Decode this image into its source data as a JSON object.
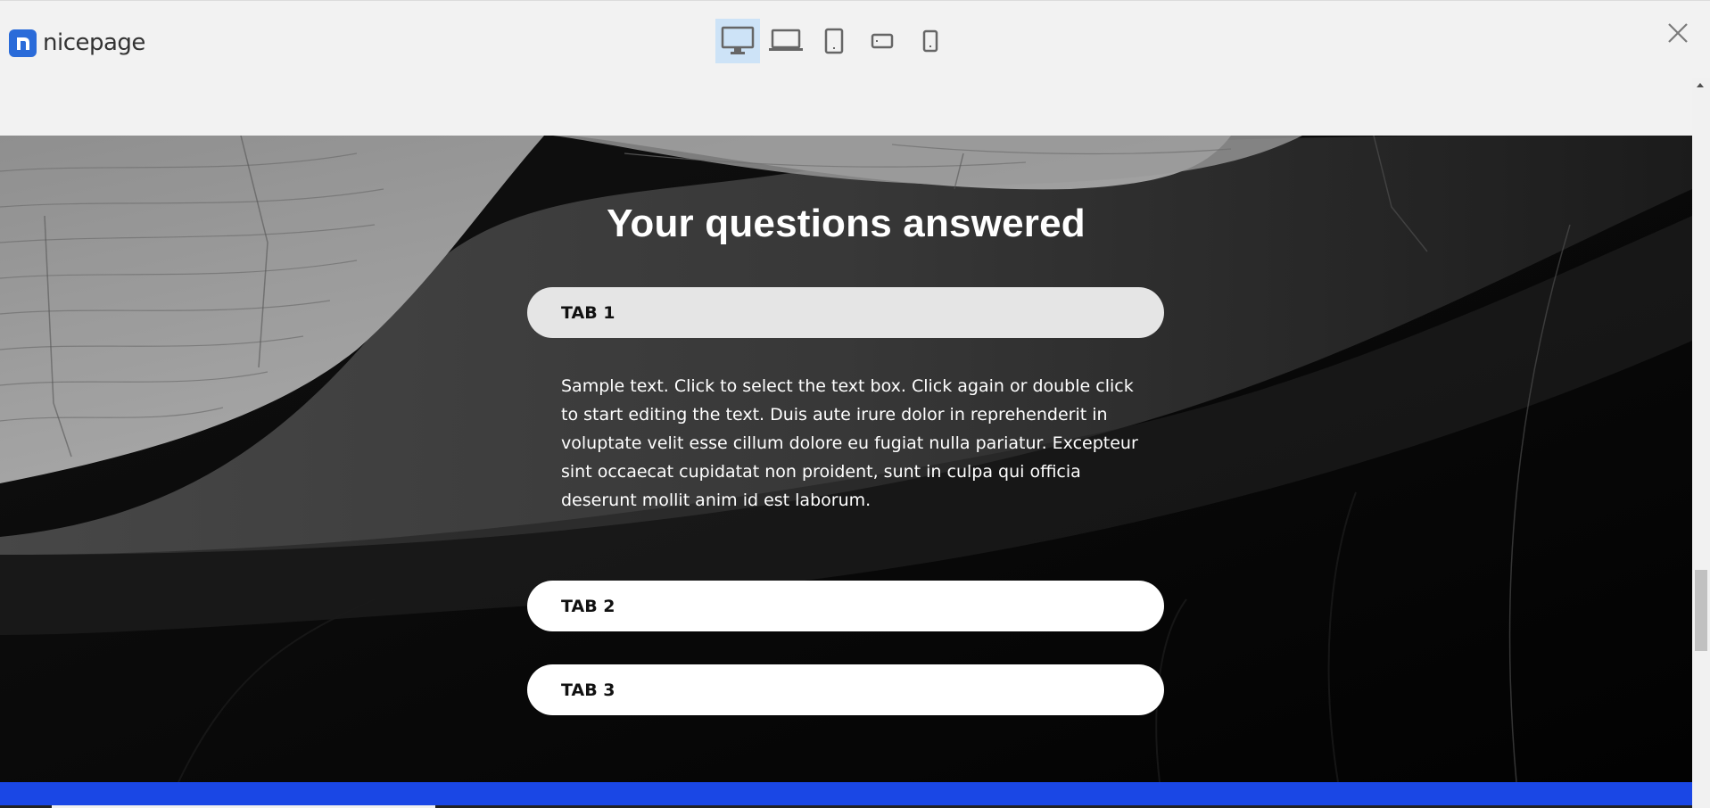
{
  "app": {
    "brand": "nicepage",
    "device_modes": [
      {
        "name": "desktop",
        "active": true
      },
      {
        "name": "laptop",
        "active": false
      },
      {
        "name": "tablet",
        "active": false
      },
      {
        "name": "phone-landscape",
        "active": false
      },
      {
        "name": "phone",
        "active": false
      }
    ],
    "accent_color": "#2a6bd9",
    "active_device_bg": "#cde3f7"
  },
  "section": {
    "title": "Your questions answered",
    "tabs": [
      {
        "label": "TAB 1",
        "expanded": true
      },
      {
        "label": "TAB 2",
        "expanded": false
      },
      {
        "label": "TAB 3",
        "expanded": false
      }
    ],
    "tab1_body": "Sample text. Click to select the text box. Click again or double click to start editing the text. Duis aute irure dolor in reprehenderit in voluptate velit esse cillum dolore eu fugiat nulla pariatur. Excepteur sint occaecat cupidatat non proident, sunt in culpa qui officia deserunt mollit anim id est laborum."
  },
  "colors": {
    "footer_strip": "#1a47e5",
    "tab_open_bg": "#e5e5e5",
    "tab_closed_bg": "#ffffff"
  }
}
